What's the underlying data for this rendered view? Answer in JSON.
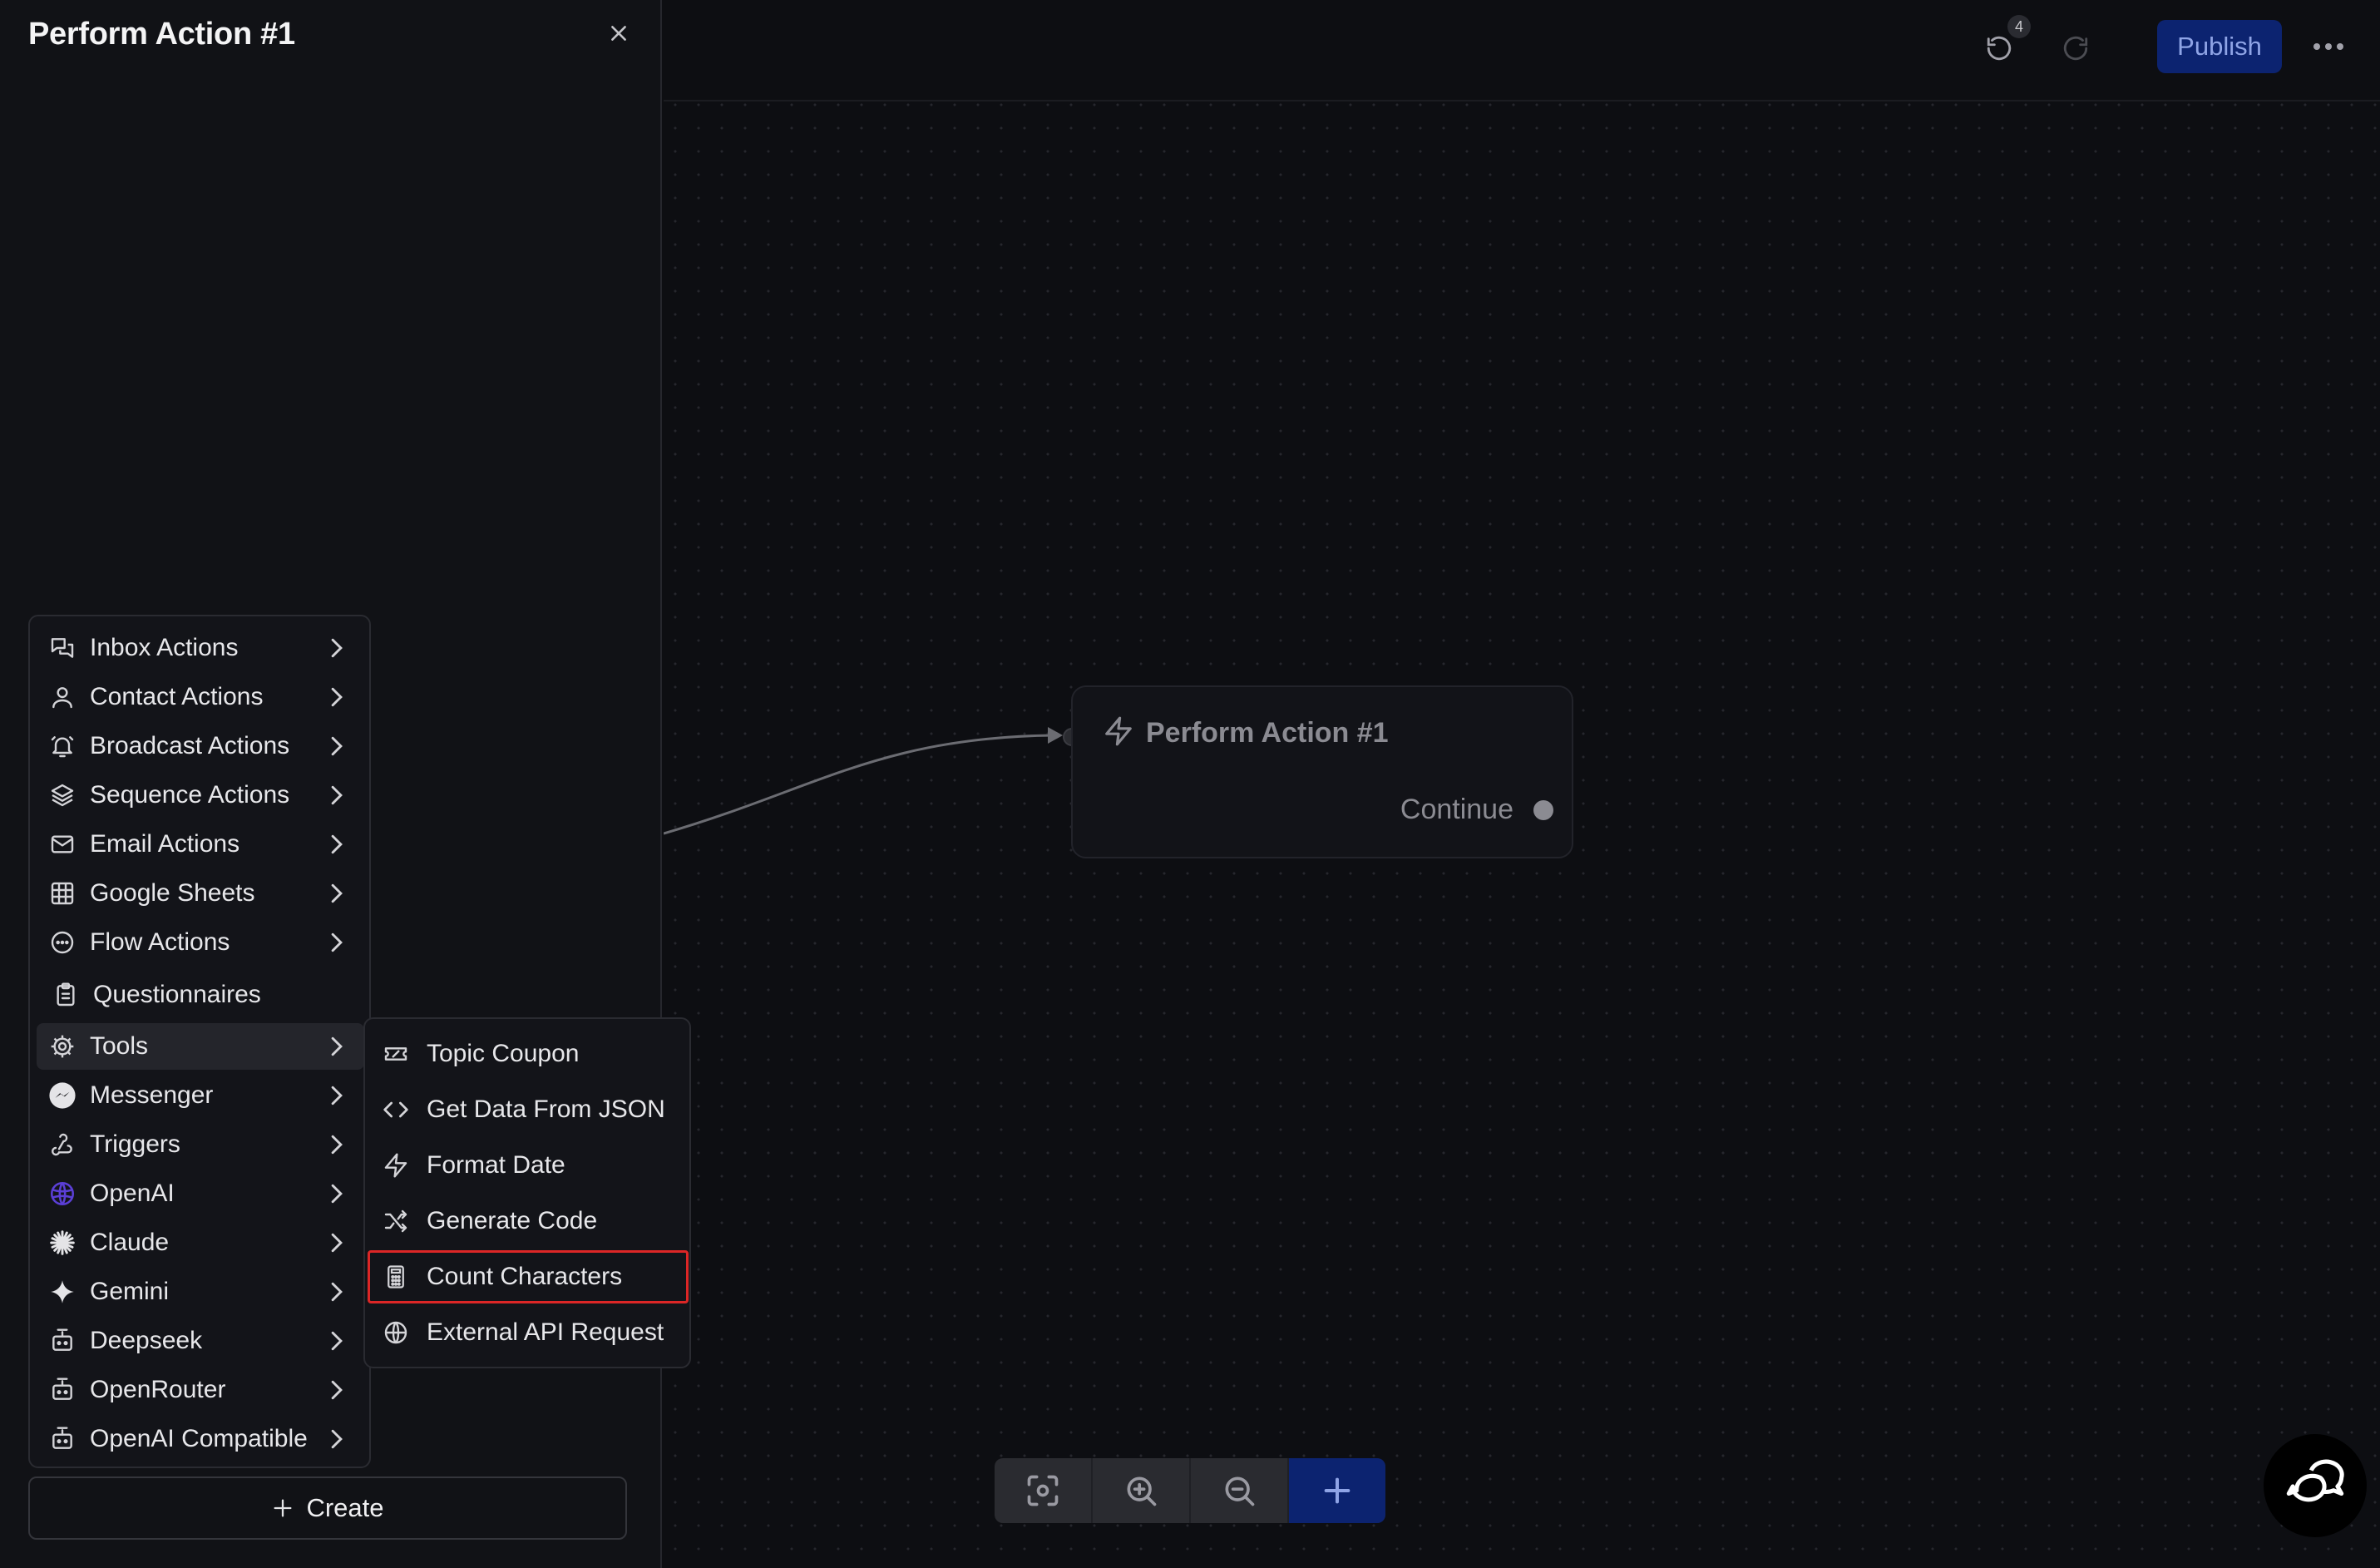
{
  "panel": {
    "title": "Perform Action #1"
  },
  "menu": {
    "items": [
      {
        "label": "Inbox Actions",
        "icon": "inbox-chat-icon",
        "has_submenu": true
      },
      {
        "label": "Contact Actions",
        "icon": "user-icon",
        "has_submenu": true
      },
      {
        "label": "Broadcast Actions",
        "icon": "bell-icon",
        "has_submenu": true
      },
      {
        "label": "Sequence Actions",
        "icon": "layers-icon",
        "has_submenu": true
      },
      {
        "label": "Email Actions",
        "icon": "mail-icon",
        "has_submenu": true
      },
      {
        "label": "Google Sheets",
        "icon": "sheet-grid-icon",
        "has_submenu": true
      },
      {
        "label": "Flow Actions",
        "icon": "dots-circle-icon",
        "has_submenu": true
      },
      {
        "label": "Questionnaires",
        "icon": "clipboard-icon",
        "has_submenu": false
      },
      {
        "label": "Tools",
        "icon": "gear-icon",
        "has_submenu": true,
        "active": true
      },
      {
        "label": "Messenger",
        "icon": "messenger-icon",
        "has_submenu": true
      },
      {
        "label": "Triggers",
        "icon": "webhook-icon",
        "has_submenu": true
      },
      {
        "label": "OpenAI",
        "icon": "openai-icon",
        "has_submenu": true
      },
      {
        "label": "Claude",
        "icon": "claude-icon",
        "has_submenu": true
      },
      {
        "label": "Gemini",
        "icon": "gemini-sparkle-icon",
        "has_submenu": true
      },
      {
        "label": "Deepseek",
        "icon": "bot-icon",
        "has_submenu": true
      },
      {
        "label": "OpenRouter",
        "icon": "bot-icon",
        "has_submenu": true
      },
      {
        "label": "OpenAI Compatible",
        "icon": "bot-icon",
        "has_submenu": true
      }
    ]
  },
  "tools_submenu": {
    "items": [
      {
        "label": "Topic Coupon",
        "icon": "ticket-icon"
      },
      {
        "label": "Get Data From JSON",
        "icon": "code-icon"
      },
      {
        "label": "Format Date",
        "icon": "zap-icon"
      },
      {
        "label": "Generate Code",
        "icon": "shuffle-icon"
      },
      {
        "label": "Count Characters",
        "icon": "calculator-icon",
        "highlighted": true
      },
      {
        "label": "External API Request",
        "icon": "globe-icon"
      }
    ]
  },
  "create_button": {
    "label": "Create"
  },
  "topbar": {
    "undo_count": "4",
    "publish_label": "Publish"
  },
  "node": {
    "title": "Perform Action #1",
    "output_label": "Continue"
  },
  "colors": {
    "background": "#0d0e12",
    "panel": "#111216",
    "accent": "#0c2370",
    "highlight_border": "#dc2626"
  }
}
